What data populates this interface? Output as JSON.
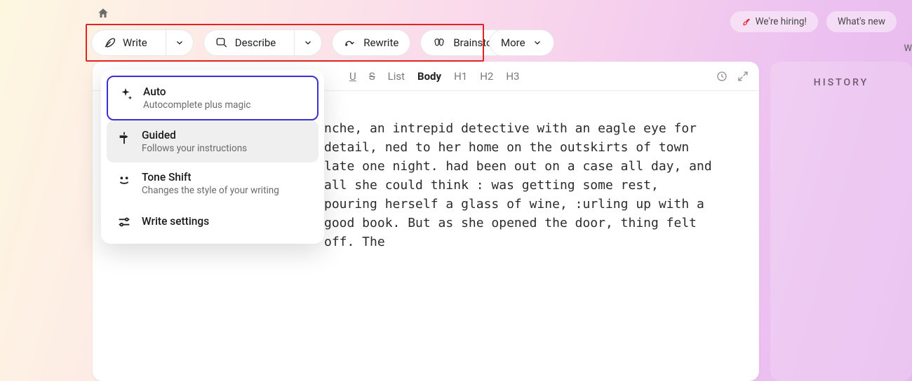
{
  "header": {
    "hiring": "We're hiring!",
    "whatsnew": "What's new",
    "crop_fragment": "W"
  },
  "actions": {
    "write": "Write",
    "describe": "Describe",
    "rewrite": "Rewrite",
    "brainstorm": "Brainstorm",
    "more": "More"
  },
  "dropdown": {
    "auto": {
      "title": "Auto",
      "sub": "Autocomplete plus magic"
    },
    "guided": {
      "title": "Guided",
      "sub": "Follows your instructions"
    },
    "tone": {
      "title": "Tone Shift",
      "sub": "Changes the style of your writing"
    },
    "settings": {
      "title": "Write settings"
    }
  },
  "format": {
    "u": "U",
    "s": "S",
    "list": "List",
    "body": "Body",
    "h1": "H1",
    "h2": "H2",
    "h3": "H3"
  },
  "document": {
    "text": "nche, an intrepid detective with an eagle eye for detail, ned to her home on the outskirts of town late one night. had been out on a case all day, and all she could think : was getting some rest, pouring herself a glass of wine, :urling up with a good book. But as she opened the door, thing felt off. The"
  },
  "sidebar": {
    "history": "HISTORY"
  }
}
